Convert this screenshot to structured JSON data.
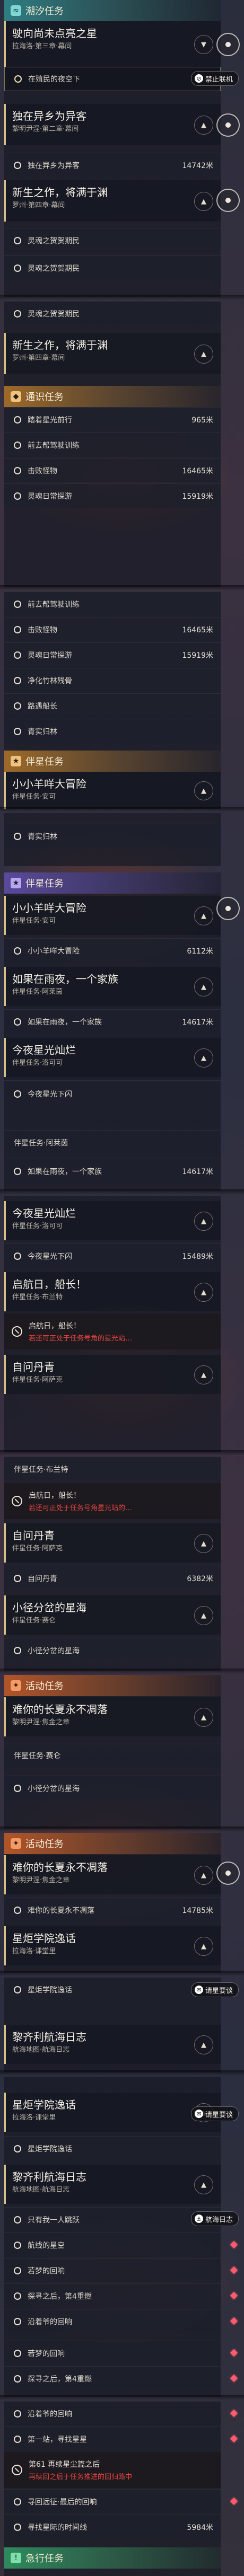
{
  "sections": {
    "tidal": "潮汐任务",
    "general": "通识任务",
    "companion": "伴星任务",
    "event": "活动任务",
    "urgent": "急行任务"
  },
  "quests": [
    {
      "title": "驶向尚未点亮之星",
      "sub": "拉海洛·第三章·幕间"
    },
    {
      "title": "独在异乡为异客",
      "sub": "黎明尹涅·第二章·幕间"
    },
    {
      "title": "新生之作，将满于渊",
      "sub": "罗州·第四章·幕间"
    },
    {
      "title": "小小羊咩大冒险",
      "sub": "伴星任务·安可"
    },
    {
      "title": "如果在雨夜，一个家族",
      "sub": "伴星任务·阿莱茵"
    },
    {
      "title": "今夜星光灿烂",
      "sub": "伴星任务·洛可可"
    },
    {
      "title": "启航日，船长！",
      "sub": "伴星任务·布兰特"
    },
    {
      "title": "自问丹青",
      "sub": "伴星任务·阿萨克"
    },
    {
      "title": "自问丹青",
      "sub": "伴星任务·阿萨克"
    },
    {
      "title": "小径分岔的星海",
      "sub": "伴星任务·赛仑"
    },
    {
      "title": "难你的长夏永不凋落",
      "sub": "黎明尹涅·焦金之章"
    },
    {
      "title": "星炬学院逸话",
      "sub": "拉海洛·课堂里",
      "badge": "课堂要谈"
    },
    {
      "title": "黎齐利航海日志",
      "sub": "航海地图·航海日志",
      "badge": "航海日志"
    }
  ],
  "steps": {
    "s_no_star": "在殖民的夜空下",
    "s_wanderer": "独在异乡为异客",
    "s_rev_hall": "灵魂之贺贺期民",
    "s_train": "前去帮驾驶训练",
    "s_fly": "踏着星光前行",
    "s_explore": "灵魂日常探游",
    "s_kill": "击败怪物",
    "s_purify": "净化竹林残骨",
    "s_pass": "路遇船长",
    "s_forest": "青实归林",
    "s_bugs": "小小羊咩大冒险",
    "s_dream": "如果在雨夜，一个家族",
    "s_lights": "今夜星光下闪",
    "s_start": "启航日，船长！",
    "s_start_warn": "若还可正处于任务号角的星光站…",
    "s_start_warn2": "若还可正处于任务号角星光站的…",
    "s_art": "自问丹青",
    "s_ran": "小径分岔的星海",
    "s_drop": "难你的长夏永不凋落",
    "s_call": "星炬学院逸话",
    "s_logbook": "只有我一人跳跃",
    "s_jump": "航线的星空",
    "s_ship2": "探寻之后，第4重燃",
    "s_ghost": "沿着爷的回响",
    "s_jump2": "若梦的回响",
    "s_shadow": "第一站，寻找星星",
    "s_wreck": "第61 再续星尘篇之后",
    "s_wreck_warn": "再续回之后于任务推进的回归路中",
    "s_research": "寻回远征·最后的回响",
    "s_last": "寻找星际的时间线"
  },
  "numbers": {
    "n1": "14742米",
    "n2": "965米",
    "n3": "16465米",
    "n4": "15919米",
    "n5": "16465米",
    "n6": "15919米",
    "n7": "6112米",
    "n8": "14617米",
    "n9": "14617米",
    "n10": "15489米",
    "n11": "6382米",
    "n12": "14785米",
    "n13": "5984米"
  },
  "buttons": {
    "disable": "禁止联机",
    "call": "请星要谈",
    "logbook": "航海日志"
  },
  "colors": {
    "accent_gold": "#d6c08a",
    "warning_red": "#e2443f",
    "marker_pink": "#ff5b6e"
  }
}
